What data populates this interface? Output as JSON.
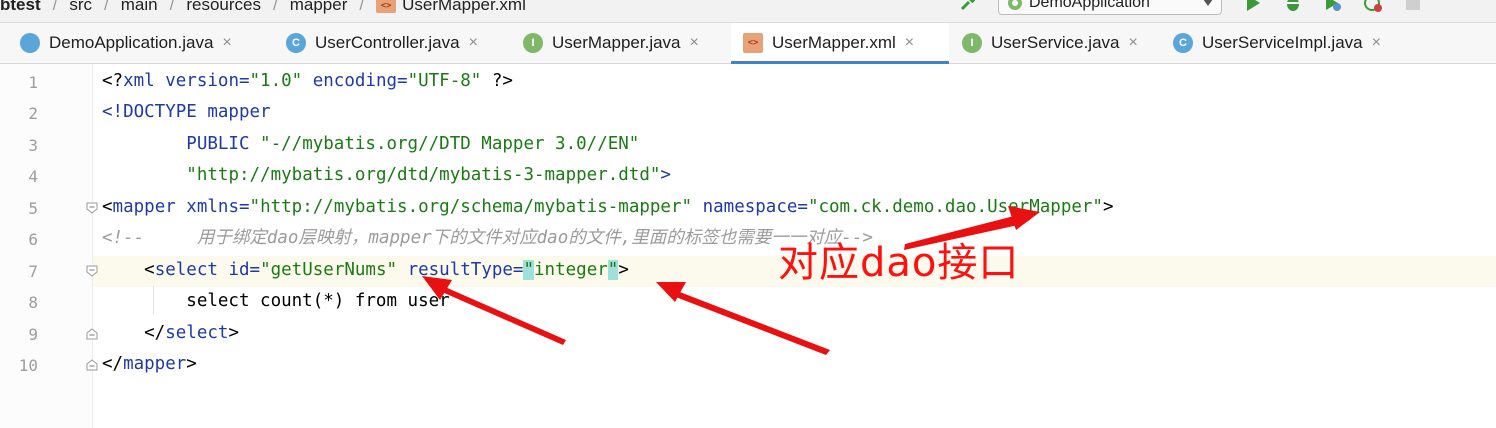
{
  "breadcrumb": [
    {
      "label": "btest"
    },
    {
      "label": "src"
    },
    {
      "label": "main"
    },
    {
      "label": "resources"
    },
    {
      "label": "mapper"
    },
    {
      "label": "UserMapper.xml",
      "icon": "xml-file-icon"
    }
  ],
  "toolbar": {
    "run_config_label": "DemoApplication",
    "icons": [
      "build-hammer-icon",
      "run-config-icon",
      "run-icon",
      "debug-icon",
      "coverage-icon",
      "profile-icon",
      "stop-icon"
    ]
  },
  "tabs": [
    {
      "label": "DemoApplication.java",
      "icon": "spring-app-icon",
      "active": false
    },
    {
      "label": "UserController.java",
      "icon": "class-icon",
      "icon_letter": "C",
      "active": false
    },
    {
      "label": "UserMapper.java",
      "icon": "interface-icon",
      "icon_letter": "I",
      "active": false
    },
    {
      "label": "UserMapper.xml",
      "icon": "xml-file-icon",
      "icon_letter": "<>",
      "active": true
    },
    {
      "label": "UserService.java",
      "icon": "interface-icon",
      "icon_letter": "I",
      "active": false
    },
    {
      "label": "UserServiceImpl.java",
      "icon": "class-icon",
      "icon_letter": "C",
      "active": false
    }
  ],
  "tab_close_glyph": "×",
  "editor": {
    "line_numbers": [
      "1",
      "2",
      "3",
      "4",
      "5",
      "6",
      "7",
      "8",
      "9",
      "10"
    ],
    "lines": {
      "l1": {
        "a": "<?",
        "b": "xml",
        "c": " version=",
        "d": "\"1.0\"",
        "e": " encoding=",
        "f": "\"UTF-8\"",
        "g": " ?>"
      },
      "l2": {
        "a": "<!DOCTYPE",
        "b": " mapper"
      },
      "l3": {
        "a": "        PUBLIC ",
        "b": "\"-//mybatis.org//DTD Mapper 3.0//EN\""
      },
      "l4": {
        "a": "        ",
        "b": "\"http://mybatis.org/dtd/mybatis-3-mapper.dtd\"",
        "c": ">"
      },
      "l5": {
        "a": "<",
        "b": "mapper",
        "c": " xmlns=",
        "d": "\"http://mybatis.org/schema/mybatis-mapper\"",
        "e": " namespace=",
        "f": "\"com.ck.demo.dao.UserMapper\"",
        "g": ">"
      },
      "l6": {
        "a": "<!--     用于绑定dao层映射，mapper下的文件对应dao的文件,里面的标签也需要一一对应-->"
      },
      "l7": {
        "a": "    <",
        "b": "select",
        "c": " id=",
        "d": "\"getUserNums\"",
        "e": " resultType=",
        "f": "\"",
        "g": "integer",
        "h": "\"",
        "i": ">"
      },
      "l8": {
        "a": "        select count(*) from user"
      },
      "l9": {
        "a": "    </",
        "b": "select",
        "c": ">"
      },
      "l10": {
        "a": "</",
        "b": "mapper",
        "c": ">"
      }
    }
  },
  "annotation": {
    "text": "对应dao接口",
    "color": "#ff1010"
  },
  "colors": {
    "tag": "#1f3aa8",
    "string": "#1b7a15",
    "comment": "#9b9b9b",
    "active_tab_underline": "#4083c9",
    "arrow": "#e81010"
  }
}
